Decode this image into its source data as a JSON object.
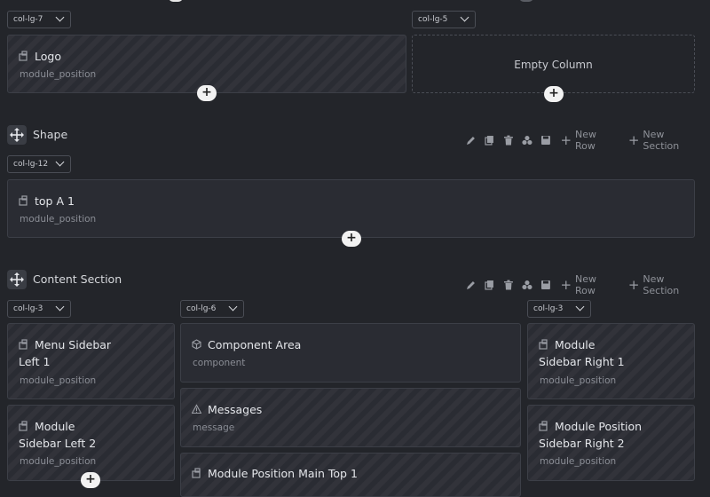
{
  "top_row": {
    "col1_select": "col-lg-7",
    "col2_select": "col-lg-5",
    "logo_card": {
      "title": "Logo",
      "subtitle": "module_position"
    },
    "empty_column": "Empty Column"
  },
  "shape_section": {
    "title": "Shape",
    "select": "col-lg-12",
    "card": {
      "title": "top A 1",
      "subtitle": "module_position"
    },
    "new_row": "New Row",
    "new_section": "New Section"
  },
  "content_section": {
    "title": "Content Section",
    "new_row": "New Row",
    "new_section": "New Section",
    "left_select": "col-lg-3",
    "mid_select": "col-lg-6",
    "right_select": "col-lg-3",
    "left_cards": [
      {
        "title_line1": "Menu Sidebar",
        "title_line2": "Left 1",
        "subtitle": "module_position"
      },
      {
        "title_line1": "Module",
        "title_line2": "Sidebar Left 2",
        "subtitle": "module_position"
      }
    ],
    "mid_cards": [
      {
        "title": "Component Area",
        "subtitle": "component"
      },
      {
        "title": "Messages",
        "subtitle": "message"
      },
      {
        "title": "Module Position Main Top 1"
      }
    ],
    "right_cards": [
      {
        "title_line1": "Module",
        "title_line2": "Sidebar Right 1",
        "subtitle": "module_position"
      },
      {
        "title_line1": "Module Position",
        "title_line2": "Sidebar Right 2",
        "subtitle": "module_position"
      }
    ]
  },
  "icons": {
    "module": "module-icon",
    "component": "cube-icon",
    "message": "warning-icon",
    "move": "move-icon",
    "edit": "pencil-icon",
    "copy": "copy-icon",
    "delete": "trash-icon",
    "settings": "gears-icon",
    "save": "save-icon",
    "add": "plus-icon"
  }
}
